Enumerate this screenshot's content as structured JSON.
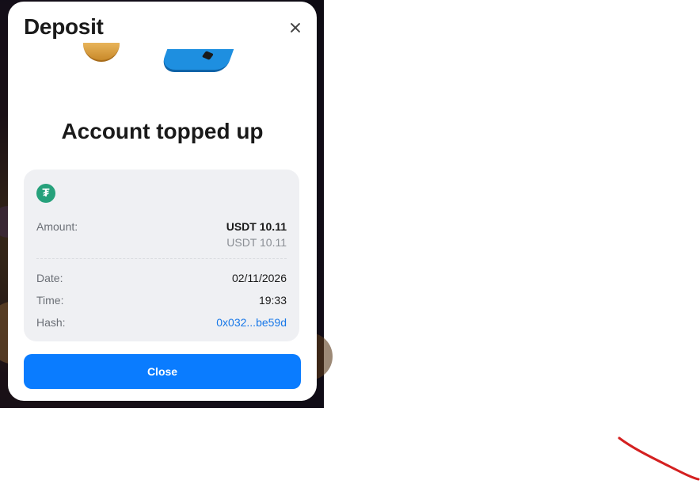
{
  "modal": {
    "title": "Deposit",
    "headline": "Account topped up",
    "token_icon": "tether-icon",
    "token_symbol": "₮",
    "amount": {
      "label": "Amount:",
      "value": "USDT 10.11",
      "secondary_value": "USDT 10.11"
    },
    "date": {
      "label": "Date:",
      "value": "02/11/2026"
    },
    "time": {
      "label": "Time:",
      "value": "19:33"
    },
    "hash": {
      "label": "Hash:",
      "value": "0x032...be59d"
    },
    "close_button": "Close"
  },
  "colors": {
    "primary_button": "#0a7cff",
    "link": "#1878e8",
    "tether_green": "#26a17b",
    "panel_bg": "#eff0f3",
    "annotation_red": "#d42020"
  }
}
